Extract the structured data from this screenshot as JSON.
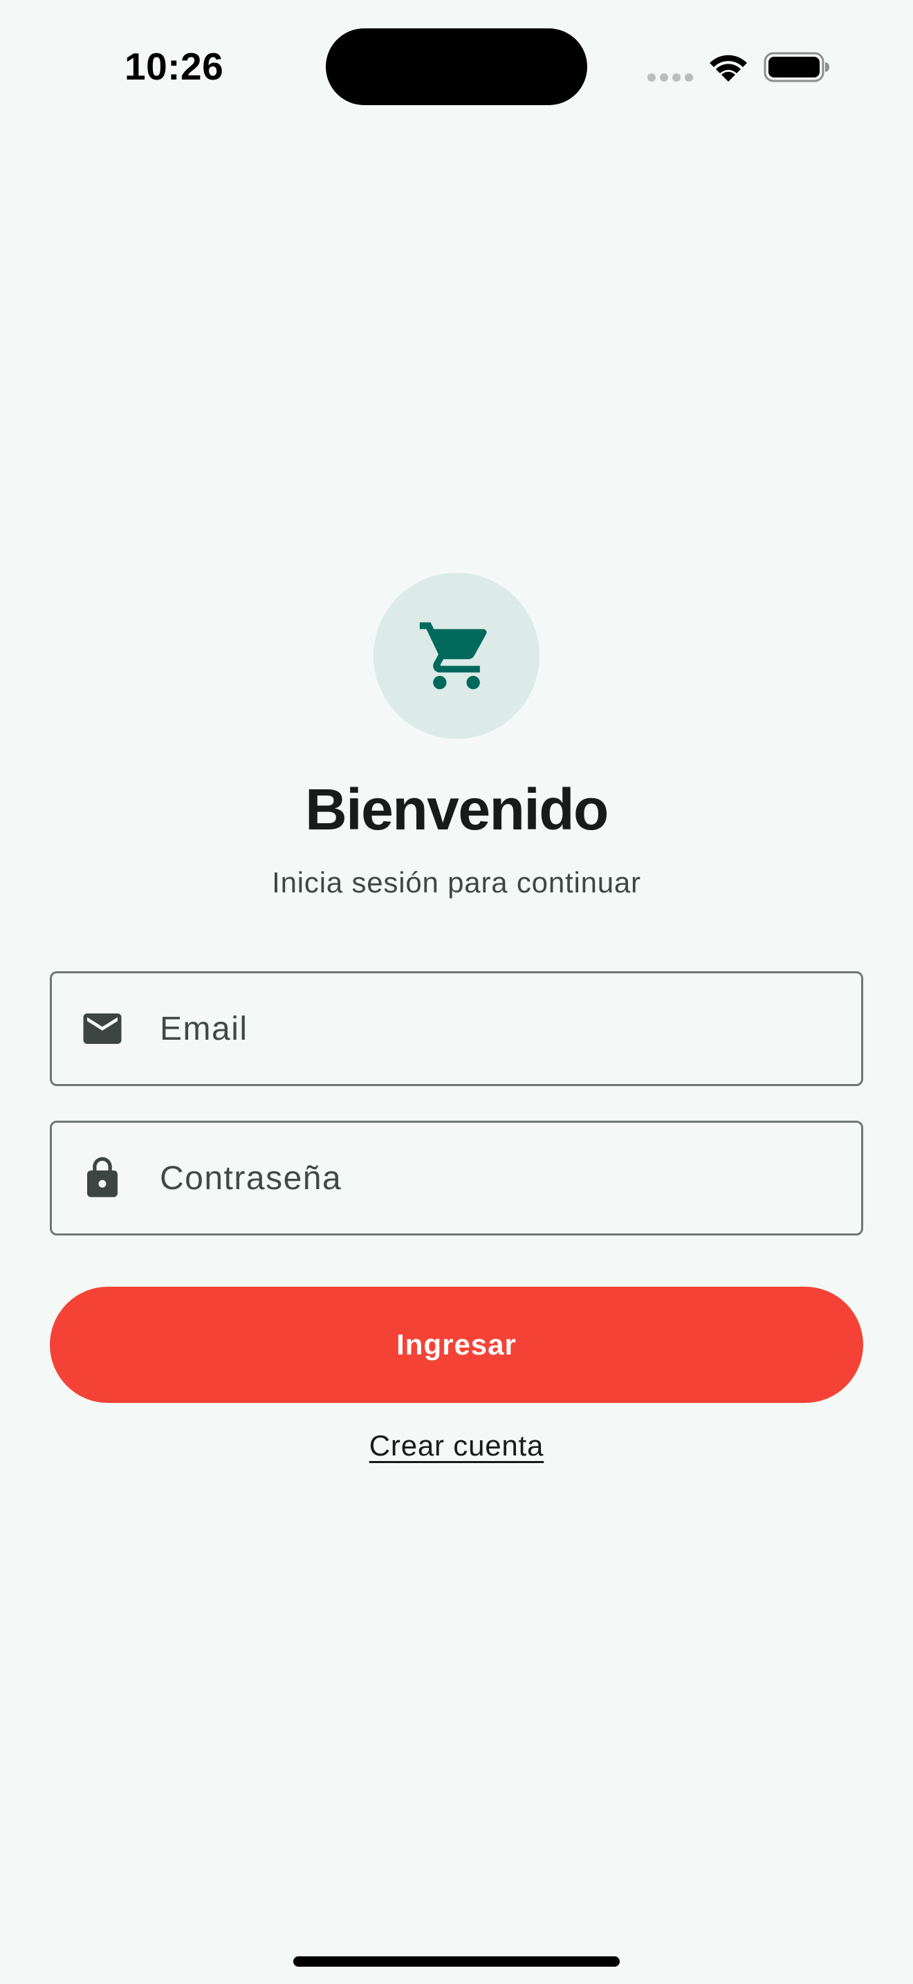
{
  "status_bar": {
    "time": "10:26",
    "icons": [
      "cellular-signal-icon",
      "wifi-icon",
      "battery-icon"
    ]
  },
  "logo": {
    "icon": "shopping-cart-icon",
    "icon_color": "#00695c",
    "circle_color": "#dcebe8"
  },
  "header": {
    "title": "Bienvenido",
    "subtitle": "Inicia sesión para continuar"
  },
  "form": {
    "email": {
      "icon": "envelope-icon",
      "placeholder": "Email",
      "value": ""
    },
    "password": {
      "icon": "lock-icon",
      "placeholder": "Contraseña",
      "value": ""
    },
    "submit_label": "Ingresar",
    "create_account_label": "Crear cuenta"
  },
  "colors": {
    "background": "#f4f9f7",
    "primary_button": "#f44336",
    "field_border": "#6f7775",
    "icon_dark": "#3d4543"
  }
}
